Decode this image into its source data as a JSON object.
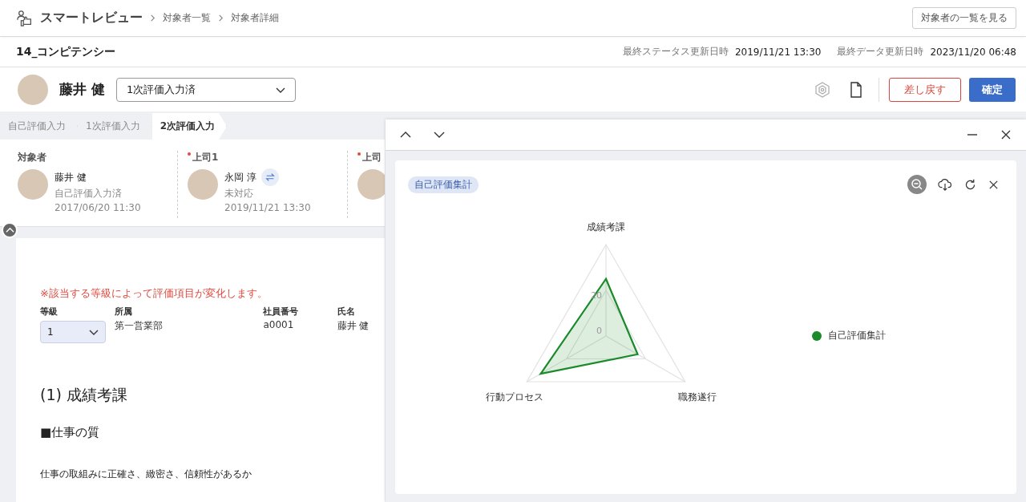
{
  "header": {
    "app_name": "スマートレビュー",
    "breadcrumbs": [
      "対象者一覧",
      "対象者詳細"
    ],
    "list_button": "対象者の一覧を見る"
  },
  "title_bar": {
    "title": "14_コンピテンシー",
    "meta": [
      {
        "label": "最終ステータス更新日時",
        "value": "2019/11/21 13:30"
      },
      {
        "label": "最終データ更新日時",
        "value": "2023/11/20 06:48"
      }
    ]
  },
  "person_bar": {
    "name": "藤井 健",
    "status_select": "1次評価入力済",
    "return_button": "差し戻す",
    "confirm_button": "確定"
  },
  "steps": [
    {
      "label": "自己評価入力",
      "selected": false
    },
    {
      "label": "1次評価入力",
      "selected": false
    },
    {
      "label": "2次評価入力",
      "selected": true
    }
  ],
  "people": [
    {
      "role": "対象者",
      "required": false,
      "name": "藤井 健",
      "status": "自己評価入力済",
      "date": "2017/06/20 11:30",
      "swap": false
    },
    {
      "role": "上司1",
      "required": true,
      "name": "永岡 淳",
      "status": "未対応",
      "date": "2019/11/21 13:30",
      "swap": true
    },
    {
      "role": "上司",
      "required": true,
      "swap": false
    }
  ],
  "form": {
    "note": "※該当する等級によって評価項目が変化します。",
    "fields": [
      {
        "kind": "select",
        "label": "等級",
        "value": "1"
      },
      {
        "kind": "text",
        "label": "所属",
        "value": "第一営業部"
      },
      {
        "kind": "text",
        "label": "社員番号",
        "value": "a0001"
      },
      {
        "kind": "text",
        "label": "氏名",
        "value": "藤井 健"
      }
    ],
    "section_heading": "(1) 成績考課",
    "subsection_heading": "■仕事の質",
    "description": "仕事の取組みに正確さ、緻密さ、信頼性があるか"
  },
  "chart_panel": {
    "tag": "自己評価集計",
    "chart_data": {
      "type": "radar",
      "categories": [
        "成績考課",
        "職務遂行",
        "行動プロセス"
      ],
      "ylim": [
        0,
        40
      ],
      "yticks": [
        0,
        20
      ],
      "series": [
        {
          "name": "自己評価集計",
          "color": "#1a8a2a",
          "values": [
            25,
            16,
            33
          ]
        }
      ]
    }
  }
}
